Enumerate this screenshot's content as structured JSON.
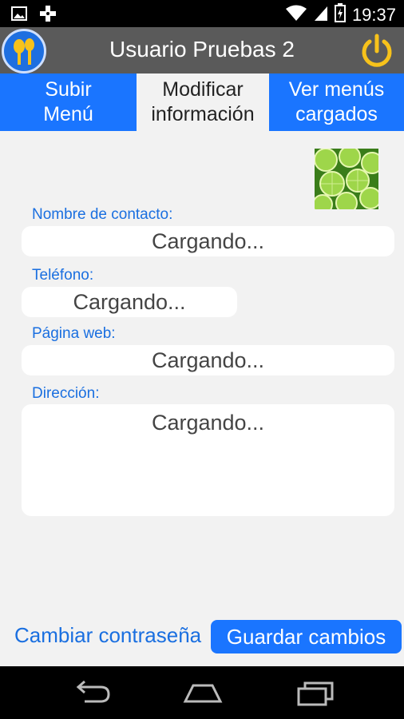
{
  "status_bar": {
    "time": "19:37",
    "icons": [
      "image-notification-icon",
      "gamepad-notification-icon",
      "wifi-icon",
      "signal-icon",
      "battery-charging-icon"
    ]
  },
  "header": {
    "title": "Usuario Pruebas 2",
    "logo_icon": "restaurant-logo-icon",
    "power_icon": "power-icon",
    "accent_color": "#f7c21b"
  },
  "tabs": [
    {
      "line1": "Subir",
      "line2": "Menú",
      "active": false
    },
    {
      "line1": "Modificar",
      "line2": "información",
      "active": true
    },
    {
      "line1": "Ver menús",
      "line2": "cargados",
      "active": false
    }
  ],
  "form": {
    "name": {
      "label": "Nombre de contacto:",
      "value": "Cargando..."
    },
    "phone": {
      "label": "Teléfono:",
      "value": "Cargando..."
    },
    "web": {
      "label": "Página web:",
      "value": "Cargando..."
    },
    "address": {
      "label": "Dirección:",
      "value": "Cargando..."
    },
    "thumbnail_icon": "lime-slices-image"
  },
  "actions": {
    "change_password": "Cambiar contraseña",
    "save": "Guardar cambios"
  },
  "nav": {
    "icons": [
      "back-icon",
      "home-icon",
      "recent-apps-icon"
    ]
  },
  "colors": {
    "primary_blue": "#1a75ff",
    "link_blue": "#1a6fe0",
    "header_gray": "#5a5a5a"
  }
}
